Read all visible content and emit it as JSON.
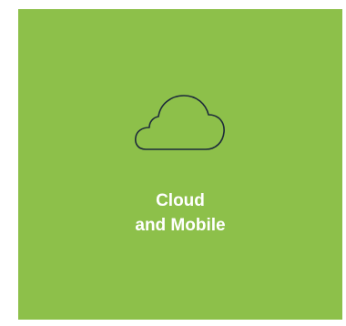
{
  "tile": {
    "line1": "Cloud",
    "line2": "and Mobile",
    "icon": "cloud-icon",
    "background_color": "#8dc04a",
    "icon_stroke_color": "#1d2a3a",
    "text_color": "#ffffff"
  }
}
